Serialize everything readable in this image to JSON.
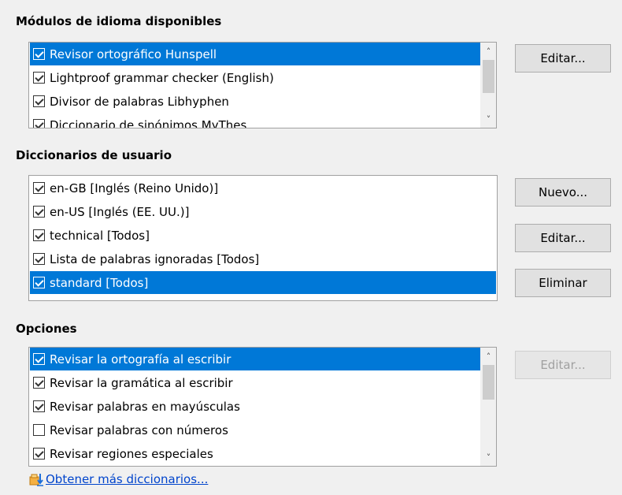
{
  "sections": {
    "modules_title": "Módulos de idioma disponibles",
    "user_dicts_title": "Diccionarios de usuario",
    "options_title": "Opciones"
  },
  "modules": {
    "items": [
      {
        "label": "Revisor ortográfico Hunspell",
        "checked": true,
        "selected": true
      },
      {
        "label": "Lightproof grammar checker (English)",
        "checked": true,
        "selected": false
      },
      {
        "label": "Divisor de palabras Libhyphen",
        "checked": true,
        "selected": false
      },
      {
        "label": "Diccionario de sinónimos MyThes",
        "checked": true,
        "selected": false
      }
    ],
    "edit_button": "Editar..."
  },
  "user_dicts": {
    "items": [
      {
        "label": "en-GB [Inglés (Reino Unido)]",
        "checked": true,
        "selected": false
      },
      {
        "label": "en-US [Inglés (EE. UU.)]",
        "checked": true,
        "selected": false
      },
      {
        "label": "technical [Todos]",
        "checked": true,
        "selected": false
      },
      {
        "label": "Lista de palabras ignoradas [Todos]",
        "checked": true,
        "selected": false
      },
      {
        "label": "standard [Todos]",
        "checked": true,
        "selected": true
      }
    ],
    "new_button": "Nuevo...",
    "edit_button": "Editar...",
    "delete_button": "Eliminar"
  },
  "options": {
    "items": [
      {
        "label": "Revisar la ortografía al escribir",
        "checked": true,
        "selected": true
      },
      {
        "label": "Revisar la gramática al escribir",
        "checked": true,
        "selected": false
      },
      {
        "label": "Revisar palabras en mayúsculas",
        "checked": true,
        "selected": false
      },
      {
        "label": "Revisar palabras con números",
        "checked": false,
        "selected": false
      },
      {
        "label": "Revisar regiones especiales",
        "checked": true,
        "selected": false
      }
    ],
    "edit_button": "Editar..."
  },
  "link": {
    "label": "Obtener más diccionarios...",
    "icon": "download-dictionary-icon"
  },
  "colors": {
    "selection": "#0078d7",
    "link": "#0044cc"
  }
}
